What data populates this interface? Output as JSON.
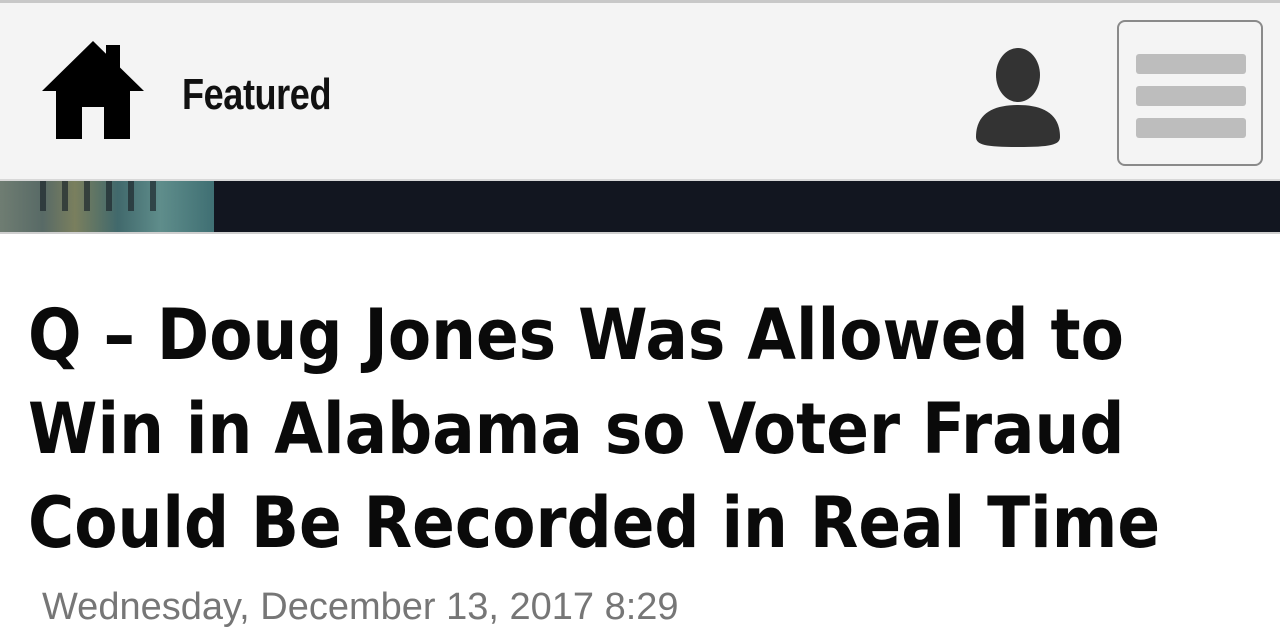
{
  "header": {
    "home_icon": "home-icon",
    "title": "Featured",
    "user_icon": "user-icon",
    "menu_icon": "hamburger-menu-icon"
  },
  "article": {
    "headline_lines": [
      "Q – Doug Jones Was Allowed to",
      "Win in Alabama so Voter Fraud",
      "Could Be Recorded in Real Time"
    ],
    "date": "Wednesday, December 13, 2017 8:29"
  },
  "colors": {
    "header_bg": "#f4f4f4",
    "banner_bg": "#121620",
    "headline_text": "#0a0a0a",
    "date_text": "#767676"
  }
}
